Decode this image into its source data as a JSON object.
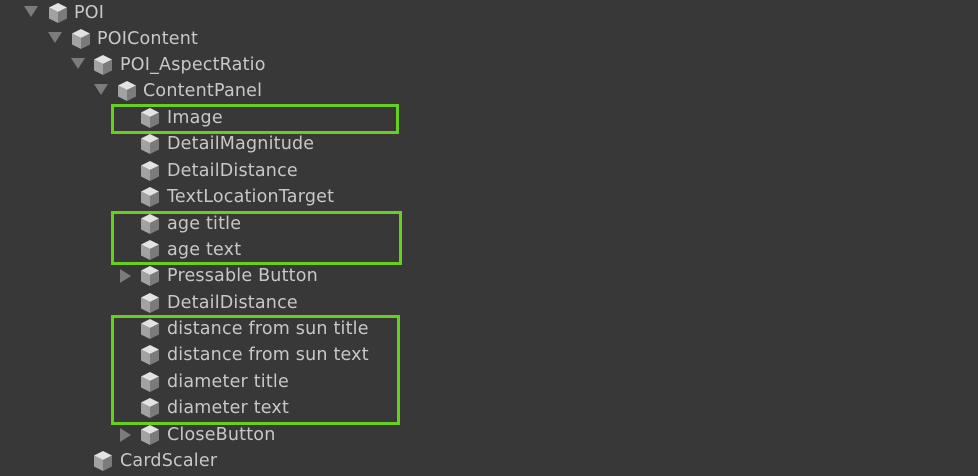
{
  "hierarchy": {
    "items": [
      {
        "label": "POI",
        "foldout": "expanded"
      },
      {
        "label": "POIContent",
        "foldout": "expanded"
      },
      {
        "label": "POI_AspectRatio",
        "foldout": "expanded"
      },
      {
        "label": "ContentPanel",
        "foldout": "expanded"
      },
      {
        "label": "Image",
        "foldout": "none"
      },
      {
        "label": "DetailMagnitude",
        "foldout": "none"
      },
      {
        "label": "DetailDistance",
        "foldout": "none"
      },
      {
        "label": "TextLocationTarget",
        "foldout": "none"
      },
      {
        "label": "age title",
        "foldout": "none"
      },
      {
        "label": "age text",
        "foldout": "none"
      },
      {
        "label": "Pressable Button",
        "foldout": "collapsed"
      },
      {
        "label": "DetailDistance",
        "foldout": "none"
      },
      {
        "label": "distance from sun title",
        "foldout": "none"
      },
      {
        "label": "distance from sun text",
        "foldout": "none"
      },
      {
        "label": "diameter title",
        "foldout": "none"
      },
      {
        "label": "diameter text",
        "foldout": "none"
      },
      {
        "label": "CloseButton",
        "foldout": "collapsed"
      },
      {
        "label": "CardScaler",
        "foldout": "none"
      }
    ]
  },
  "colors": {
    "background": "#383838",
    "text": "#c8c8c8",
    "highlight": "#66d01d",
    "foldout_arrow": "#7c7c7c"
  },
  "icons": {
    "gameobject": "cube-icon",
    "expanded": "triangle-down-icon",
    "collapsed": "triangle-right-icon"
  }
}
